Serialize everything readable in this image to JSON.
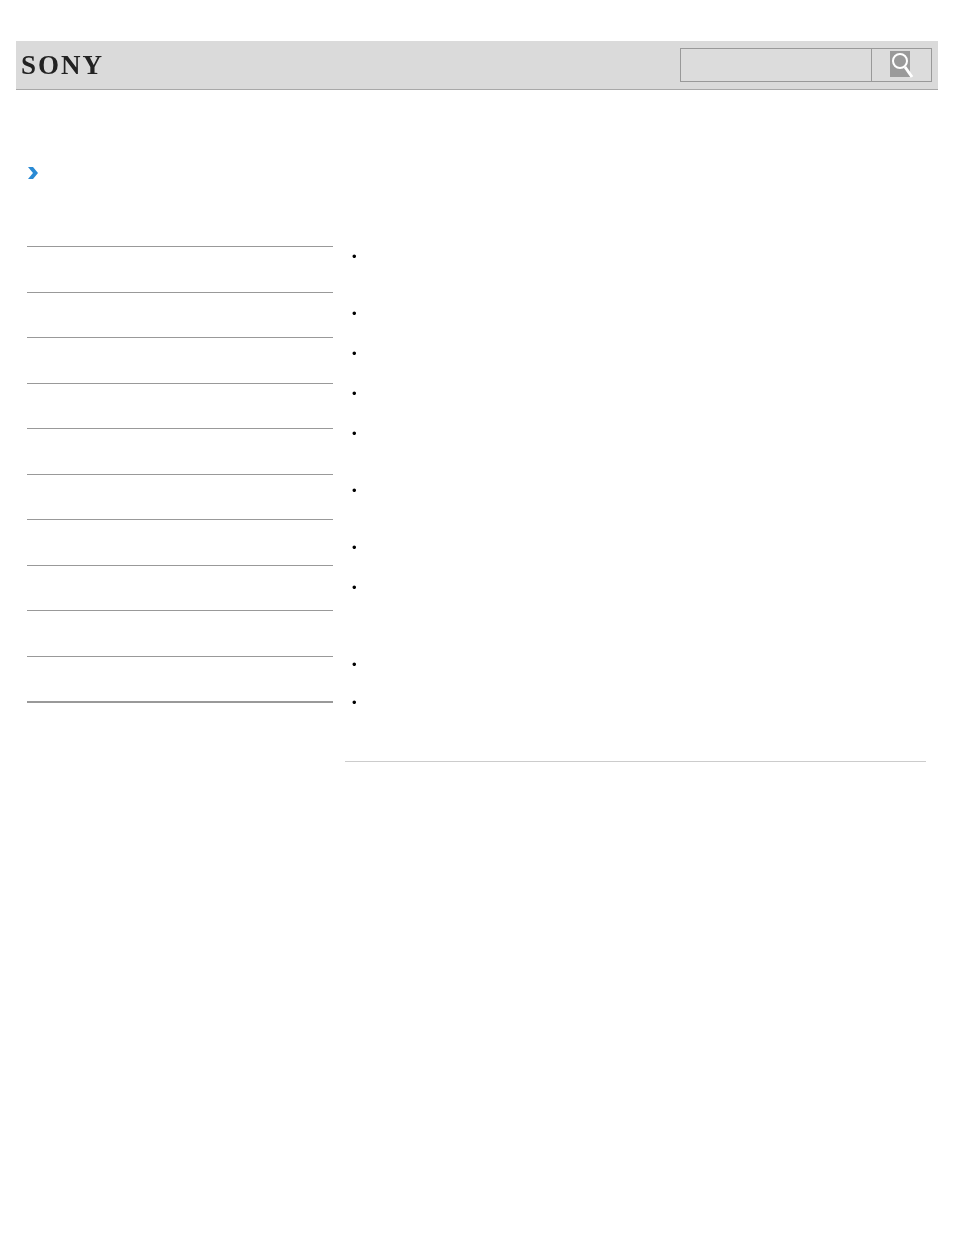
{
  "header": {
    "logo": "SONY"
  },
  "content": {
    "sections": [
      {
        "bullets": [
          "•"
        ]
      },
      {
        "bullets": [
          "•",
          "•",
          "•",
          "•"
        ]
      },
      {
        "bullets": [
          "•"
        ]
      },
      {
        "bullets": [
          "•",
          "•"
        ]
      },
      {
        "bullets": [
          "•"
        ]
      },
      {
        "bullets": [
          "•"
        ]
      }
    ]
  }
}
